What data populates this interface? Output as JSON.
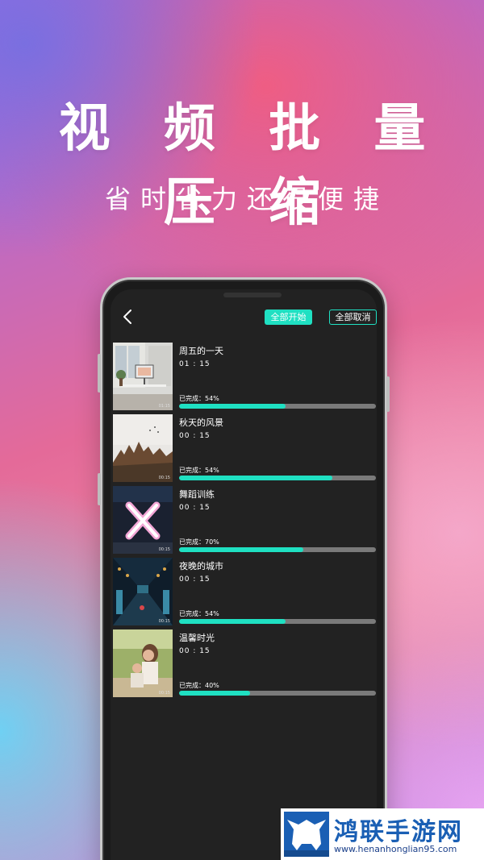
{
  "headline": "视 频 批 量 压 缩",
  "subline": "省时省力还很便捷",
  "header": {
    "start_all": "全部开始",
    "cancel_all": "全部取消"
  },
  "videos": [
    {
      "title": "周五的一天",
      "time": "01 : 15",
      "status": "已完成：54%",
      "progress": 0.54
    },
    {
      "title": "秋天的风景",
      "time": "00 : 15",
      "status": "已完成：54%",
      "progress": 0.78
    },
    {
      "title": "舞蹈训练",
      "time": "00 : 15",
      "status": "已完成：70%",
      "progress": 0.63
    },
    {
      "title": "夜晚的城市",
      "time": "00 : 15",
      "status": "已完成：54%",
      "progress": 0.54
    },
    {
      "title": "温馨时光",
      "time": "00 : 15",
      "status": "已完成：40%",
      "progress": 0.36
    }
  ],
  "thumb_durations": [
    "01:15",
    "00:15",
    "00:15",
    "00:15",
    "00:15"
  ],
  "watermark": {
    "title": "鸿联手游网",
    "url": "www.henanhonglian95.com"
  },
  "colors": {
    "accent": "#1fe0c2",
    "track": "#7a7a7a",
    "screen_bg": "#222222"
  }
}
